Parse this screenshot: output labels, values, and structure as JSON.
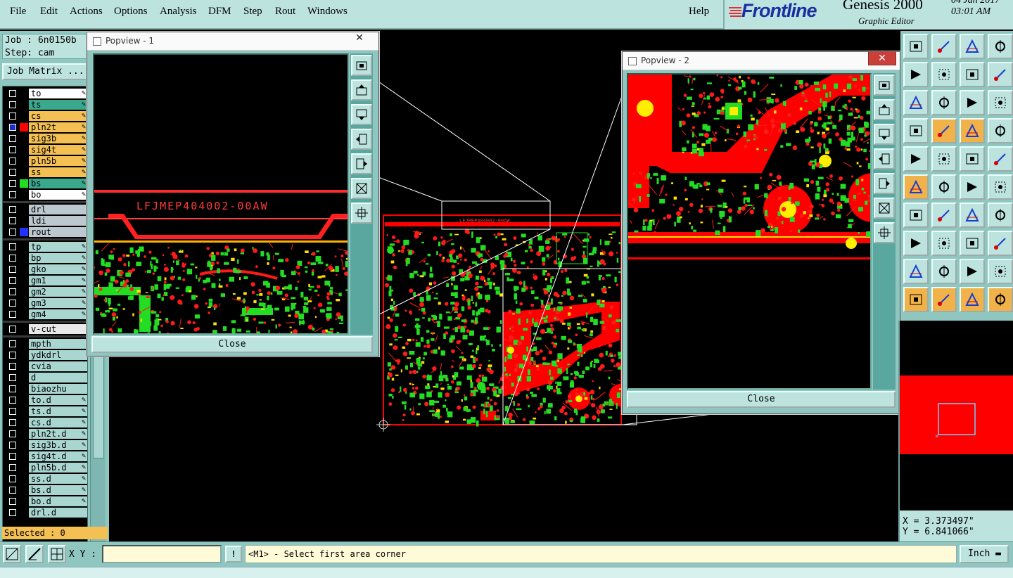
{
  "menu": {
    "items": [
      "File",
      "Edit",
      "Actions",
      "Options",
      "Analysis",
      "DFM",
      "Step",
      "Rout",
      "Windows"
    ],
    "help": "Help"
  },
  "brand": {
    "logo": "Frontline",
    "app": "Genesis 2000",
    "subtitle": "Graphic Editor",
    "date": "04 Jan 2017",
    "time": "03:01 AM"
  },
  "job": {
    "job_label": "Job : 6n0150b",
    "step_label": "Step: cam",
    "matrix_button": "Job Matrix ..."
  },
  "layers": [
    {
      "name": "to",
      "color": "#ffffff",
      "checked": false,
      "swatch": "",
      "icon": true
    },
    {
      "name": "ts",
      "color": "#3aa88c",
      "checked": false,
      "swatch": "",
      "icon": true
    },
    {
      "name": "cs",
      "color": "#f4c054",
      "checked": false,
      "swatch": "",
      "icon": true
    },
    {
      "name": "pln2t",
      "color": "#f4c054",
      "checked": true,
      "swatch": "#ff0000",
      "icon": true
    },
    {
      "name": "sig3b",
      "color": "#f4c054",
      "checked": false,
      "swatch": "",
      "icon": true
    },
    {
      "name": "sig4t",
      "color": "#f4c054",
      "checked": false,
      "swatch": "",
      "icon": true
    },
    {
      "name": "pln5b",
      "color": "#f4c054",
      "checked": false,
      "swatch": "",
      "icon": true
    },
    {
      "name": "ss",
      "color": "#f4c054",
      "checked": false,
      "swatch": "",
      "icon": true
    },
    {
      "name": "bs",
      "color": "#3aa88c",
      "checked": false,
      "swatch": "#22dd22",
      "icon": true
    },
    {
      "name": "bo",
      "color": "#ffffff",
      "checked": false,
      "swatch": "",
      "icon": true
    },
    {
      "name": "drl",
      "color": "#bcc8d0",
      "checked": false,
      "swatch": "",
      "icon": false
    },
    {
      "name": "ldi",
      "color": "#bcc8d0",
      "checked": false,
      "swatch": "",
      "icon": false
    },
    {
      "name": "rout",
      "color": "#bcc8d0",
      "checked": false,
      "swatch": "#2233ff",
      "icon": false
    },
    {
      "name": "tp",
      "color": "#a9d6d1",
      "checked": false,
      "swatch": "",
      "icon": true
    },
    {
      "name": "bp",
      "color": "#a9d6d1",
      "checked": false,
      "swatch": "",
      "icon": true
    },
    {
      "name": "gko",
      "color": "#a9d6d1",
      "checked": false,
      "swatch": "",
      "icon": true
    },
    {
      "name": "gm1",
      "color": "#a9d6d1",
      "checked": false,
      "swatch": "",
      "icon": true
    },
    {
      "name": "gm2",
      "color": "#a9d6d1",
      "checked": false,
      "swatch": "",
      "icon": true
    },
    {
      "name": "gm3",
      "color": "#a9d6d1",
      "checked": false,
      "swatch": "",
      "icon": true
    },
    {
      "name": "gm4",
      "color": "#a9d6d1",
      "checked": false,
      "swatch": "",
      "icon": true
    },
    {
      "name": "v-cut",
      "color": "#e8e8e8",
      "checked": false,
      "swatch": "",
      "icon": false
    },
    {
      "name": "mpth",
      "color": "#a9d6d1",
      "checked": false,
      "swatch": "",
      "icon": false
    },
    {
      "name": "ydkdrl",
      "color": "#a9d6d1",
      "checked": false,
      "swatch": "",
      "icon": false
    },
    {
      "name": "cvia",
      "color": "#a9d6d1",
      "checked": false,
      "swatch": "",
      "icon": false
    },
    {
      "name": "d",
      "color": "#a9d6d1",
      "checked": false,
      "swatch": "",
      "icon": false
    },
    {
      "name": "biaozhu",
      "color": "#a9d6d1",
      "checked": false,
      "swatch": "",
      "icon": false
    },
    {
      "name": "to.d",
      "color": "#a9d6d1",
      "checked": false,
      "swatch": "",
      "icon": true
    },
    {
      "name": "ts.d",
      "color": "#a9d6d1",
      "checked": false,
      "swatch": "",
      "icon": true
    },
    {
      "name": "cs.d",
      "color": "#a9d6d1",
      "checked": false,
      "swatch": "",
      "icon": true
    },
    {
      "name": "pln2t.d",
      "color": "#a9d6d1",
      "checked": false,
      "swatch": "",
      "icon": true
    },
    {
      "name": "sig3b.d",
      "color": "#a9d6d1",
      "checked": false,
      "swatch": "",
      "icon": true
    },
    {
      "name": "sig4t.d",
      "color": "#a9d6d1",
      "checked": false,
      "swatch": "",
      "icon": true
    },
    {
      "name": "pln5b.d",
      "color": "#a9d6d1",
      "checked": false,
      "swatch": "",
      "icon": true
    },
    {
      "name": "ss.d",
      "color": "#a9d6d1",
      "checked": false,
      "swatch": "",
      "icon": true
    },
    {
      "name": "bs.d",
      "color": "#a9d6d1",
      "checked": false,
      "swatch": "",
      "icon": true
    },
    {
      "name": "bo.d",
      "color": "#a9d6d1",
      "checked": false,
      "swatch": "",
      "icon": true
    },
    {
      "name": "drl.d",
      "color": "#a9d6d1",
      "checked": false,
      "swatch": "",
      "icon": false
    }
  ],
  "selected": "Selected : 0",
  "popview1": {
    "title": "Popview - 1",
    "close": "Close",
    "board_text": "LFJMEP404002-00AW",
    "close_x": "✕"
  },
  "popview2": {
    "title": "Popview - 2",
    "close": "Close",
    "close_x": "✕"
  },
  "main_board_text": "LFJMEP404002-00AW",
  "coords": {
    "x": "X = 3.373497\"",
    "y": "Y = 6.841066\""
  },
  "bottom": {
    "xy_label": "X Y :",
    "xy_value": "",
    "bang": "!",
    "prompt": "<M1> - Select first area corner",
    "unit": "Inch"
  },
  "colors": {
    "panel": "#8fc6c0",
    "panel_light": "#bde3df",
    "copper": "#ff0000",
    "pad": "#22dd22",
    "drill": "#ffee00"
  }
}
